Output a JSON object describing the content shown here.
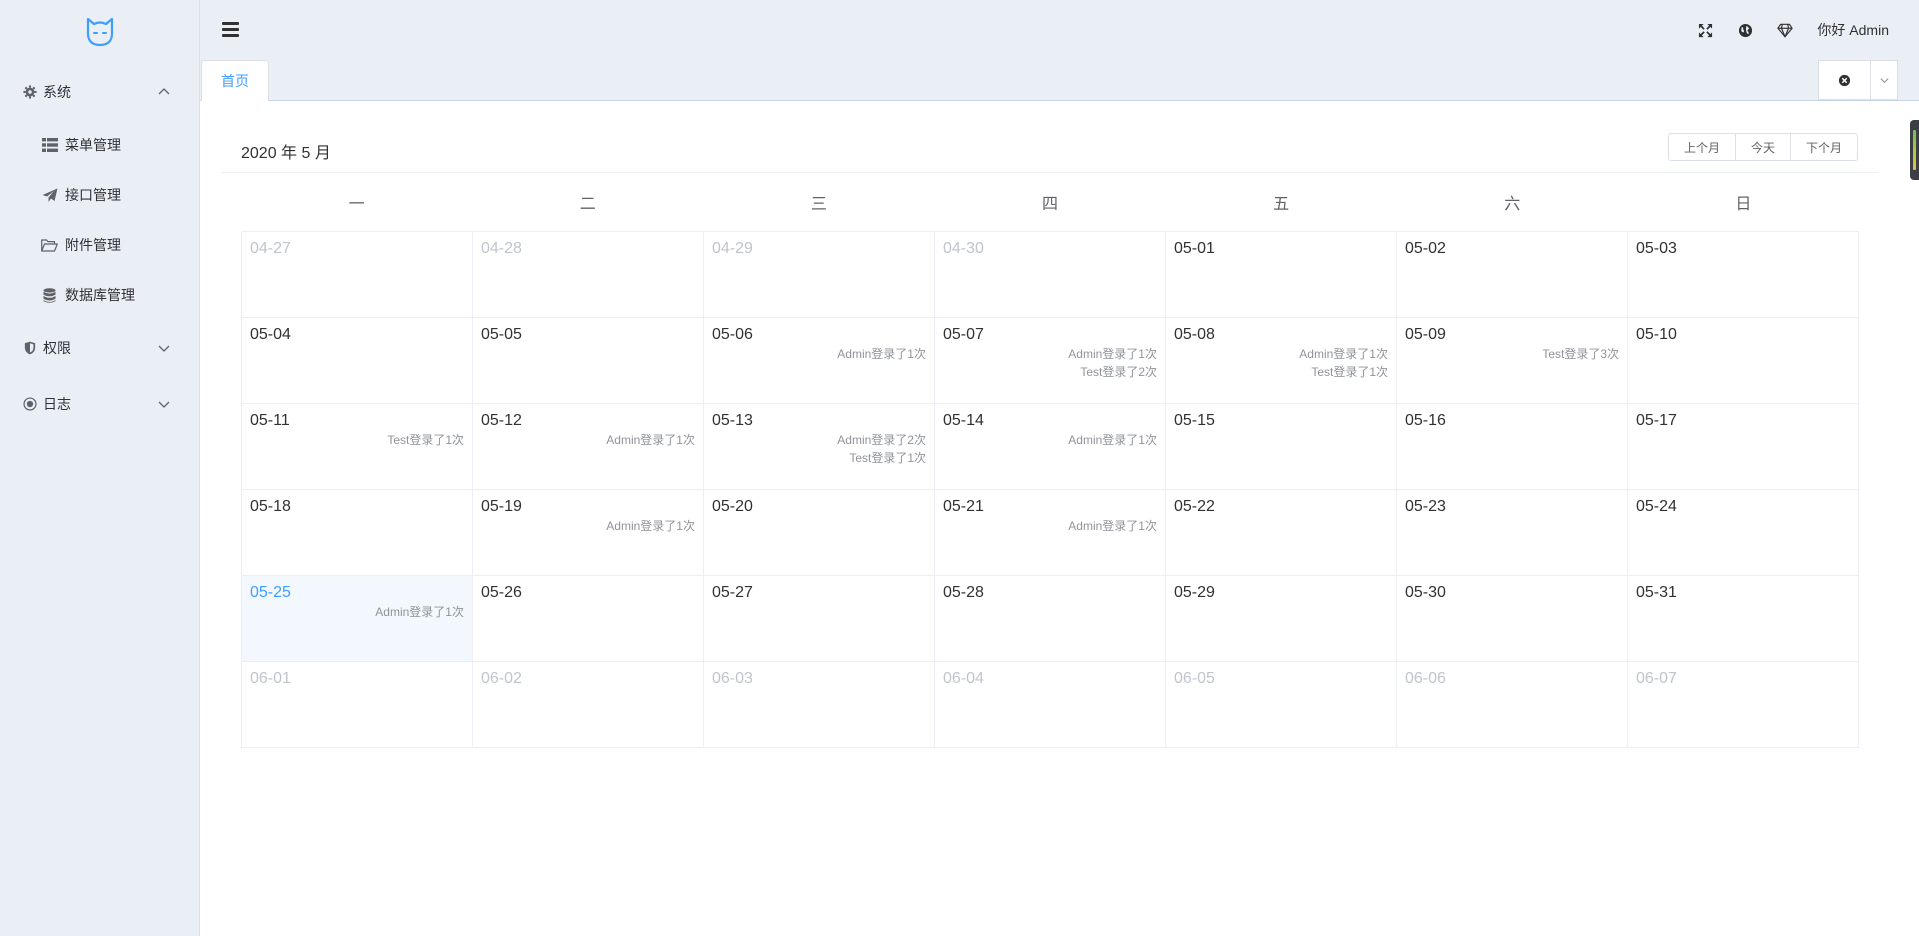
{
  "sidebar": {
    "groups": [
      {
        "label": "系统",
        "icon": "gear-icon",
        "expanded": true,
        "items": [
          {
            "label": "菜单管理",
            "icon": "list-icon"
          },
          {
            "label": "接口管理",
            "icon": "paper-plane-icon"
          },
          {
            "label": "附件管理",
            "icon": "folder-open-icon"
          },
          {
            "label": "数据库管理",
            "icon": "database-icon"
          }
        ]
      },
      {
        "label": "权限",
        "icon": "shield-icon",
        "expanded": false
      },
      {
        "label": "日志",
        "icon": "target-icon",
        "expanded": false
      }
    ]
  },
  "header": {
    "greeting": "你好 Admin",
    "icons": [
      "fullscreen-icon",
      "globe-icon",
      "diamond-icon"
    ]
  },
  "tabs": {
    "items": [
      {
        "label": "首页",
        "active": true
      }
    ]
  },
  "calendar": {
    "title": "2020 年 5 月",
    "buttons": {
      "prev": "上个月",
      "today": "今天",
      "next": "下个月"
    },
    "weekdays": [
      "一",
      "二",
      "三",
      "四",
      "五",
      "六",
      "日"
    ],
    "days": [
      {
        "date": "04-27",
        "other": true,
        "events": []
      },
      {
        "date": "04-28",
        "other": true,
        "events": []
      },
      {
        "date": "04-29",
        "other": true,
        "events": []
      },
      {
        "date": "04-30",
        "other": true,
        "events": []
      },
      {
        "date": "05-01",
        "events": []
      },
      {
        "date": "05-02",
        "events": []
      },
      {
        "date": "05-03",
        "events": []
      },
      {
        "date": "05-04",
        "events": []
      },
      {
        "date": "05-05",
        "events": []
      },
      {
        "date": "05-06",
        "events": [
          "Admin登录了1次"
        ]
      },
      {
        "date": "05-07",
        "events": [
          "Admin登录了1次",
          "Test登录了2次"
        ]
      },
      {
        "date": "05-08",
        "events": [
          "Admin登录了1次",
          "Test登录了1次"
        ]
      },
      {
        "date": "05-09",
        "events": [
          "Test登录了3次"
        ]
      },
      {
        "date": "05-10",
        "events": []
      },
      {
        "date": "05-11",
        "events": [
          "Test登录了1次"
        ]
      },
      {
        "date": "05-12",
        "events": [
          "Admin登录了1次"
        ]
      },
      {
        "date": "05-13",
        "events": [
          "Admin登录了2次",
          "Test登录了1次"
        ]
      },
      {
        "date": "05-14",
        "events": [
          "Admin登录了1次"
        ]
      },
      {
        "date": "05-15",
        "events": []
      },
      {
        "date": "05-16",
        "events": []
      },
      {
        "date": "05-17",
        "events": []
      },
      {
        "date": "05-18",
        "events": []
      },
      {
        "date": "05-19",
        "events": [
          "Admin登录了1次"
        ]
      },
      {
        "date": "05-20",
        "events": []
      },
      {
        "date": "05-21",
        "events": [
          "Admin登录了1次"
        ]
      },
      {
        "date": "05-22",
        "events": []
      },
      {
        "date": "05-23",
        "events": []
      },
      {
        "date": "05-24",
        "events": []
      },
      {
        "date": "05-25",
        "today": true,
        "events": [
          "Admin登录了1次"
        ]
      },
      {
        "date": "05-26",
        "events": []
      },
      {
        "date": "05-27",
        "events": []
      },
      {
        "date": "05-28",
        "events": []
      },
      {
        "date": "05-29",
        "events": []
      },
      {
        "date": "05-30",
        "events": []
      },
      {
        "date": "05-31",
        "events": []
      },
      {
        "date": "06-01",
        "other": true,
        "events": []
      },
      {
        "date": "06-02",
        "other": true,
        "events": []
      },
      {
        "date": "06-03",
        "other": true,
        "events": []
      },
      {
        "date": "06-04",
        "other": true,
        "events": []
      },
      {
        "date": "06-05",
        "other": true,
        "events": []
      },
      {
        "date": "06-06",
        "other": true,
        "events": []
      },
      {
        "date": "06-07",
        "other": true,
        "events": []
      }
    ]
  },
  "colors": {
    "accent": "#409eff",
    "today_bg": "#f2f8fe",
    "muted_date": "#c0c4cc",
    "event_text": "#909399",
    "background": "#eaeef5"
  }
}
